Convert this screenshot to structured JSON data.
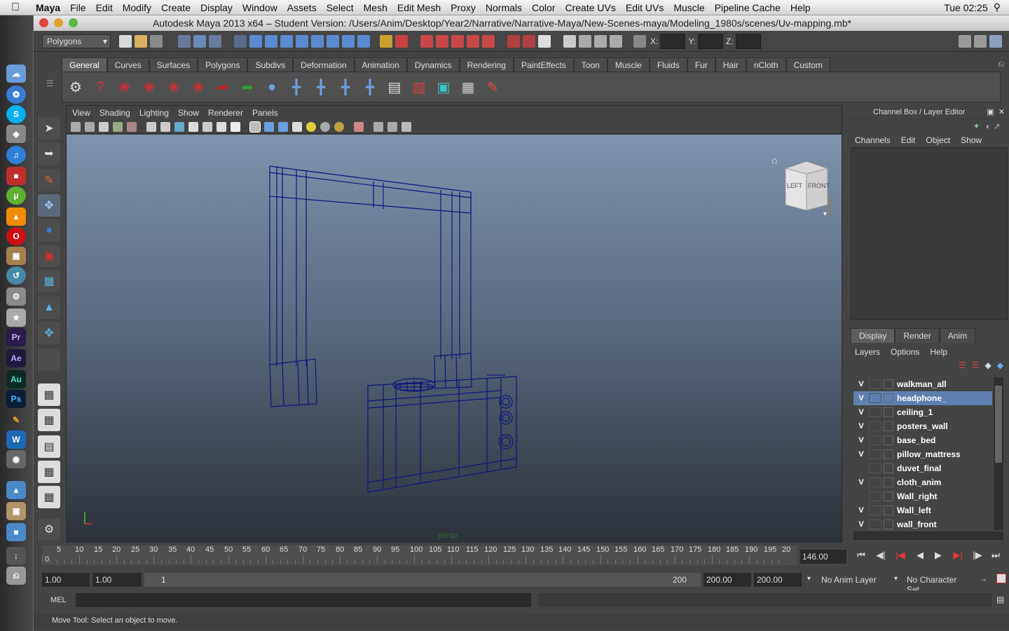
{
  "mac_menu": {
    "app": "Maya",
    "items": [
      "File",
      "Edit",
      "Modify",
      "Create",
      "Display",
      "Window",
      "Assets",
      "Select",
      "Mesh",
      "Edit Mesh",
      "Proxy",
      "Normals",
      "Color",
      "Create UVs",
      "Edit UVs",
      "Muscle",
      "Pipeline Cache",
      "Help"
    ],
    "clock": "Tue 02:25"
  },
  "window": {
    "title": "Autodesk Maya 2013 x64 – Student Version: /Users/Anim/Desktop/Year2/Narrative/Narrative-Maya/New-Scenes-maya/Modeling_1980s/scenes/Uv-mapping.mb*"
  },
  "toolbar": {
    "mode": "Polygons",
    "x_label": "X:",
    "y_label": "Y:",
    "z_label": "Z:"
  },
  "shelf_tabs": [
    "General",
    "Curves",
    "Surfaces",
    "Polygons",
    "Subdivs",
    "Deformation",
    "Animation",
    "Dynamics",
    "Rendering",
    "PaintEffects",
    "Toon",
    "Muscle",
    "Fluids",
    "Fur",
    "Hair",
    "nCloth",
    "Custom"
  ],
  "viewport": {
    "menu": [
      "View",
      "Shading",
      "Lighting",
      "Show",
      "Renderer",
      "Panels"
    ],
    "camera_label": "persp",
    "cube_left": "LEFT",
    "cube_front": "FRONT"
  },
  "channel_box": {
    "title": "Channel Box / Layer Editor",
    "menu": [
      "Channels",
      "Edit",
      "Object",
      "Show"
    ]
  },
  "layer_editor": {
    "tabs": [
      "Display",
      "Render",
      "Anim"
    ],
    "menu": [
      "Layers",
      "Options",
      "Help"
    ],
    "layers": [
      {
        "v": "V",
        "name": "walkman_all"
      },
      {
        "v": "V",
        "name": "headphone_"
      },
      {
        "v": "V",
        "name": "ceiling_1"
      },
      {
        "v": "V",
        "name": "posters_wall"
      },
      {
        "v": "V",
        "name": "base_bed"
      },
      {
        "v": "V",
        "name": "pillow_mattress"
      },
      {
        "v": "",
        "name": "duvet_final"
      },
      {
        "v": "V",
        "name": "cloth_anim"
      },
      {
        "v": "",
        "name": "Wall_right"
      },
      {
        "v": "V",
        "name": "Wall_left"
      },
      {
        "v": "V",
        "name": "wall_front"
      }
    ]
  },
  "timeline": {
    "ticks": [
      "5",
      "10",
      "15",
      "20",
      "25",
      "30",
      "35",
      "40",
      "45",
      "50",
      "55",
      "60",
      "65",
      "70",
      "75",
      "80",
      "85",
      "90",
      "95",
      "100",
      "105",
      "110",
      "115",
      "120",
      "125",
      "130",
      "135",
      "140",
      "145",
      "150",
      "155",
      "160",
      "165",
      "170",
      "175",
      "180",
      "185",
      "190",
      "195",
      "20"
    ],
    "start_tick": "0",
    "current_frame": "146.00"
  },
  "range": {
    "start": "1.00",
    "playback_start": "1.00",
    "slider_start": "1",
    "slider_end": "200",
    "playback_end": "200.00",
    "end": "200.00",
    "anim_layer": "No Anim Layer",
    "character_set": "No Character Set"
  },
  "command": {
    "lang": "MEL"
  },
  "help_line": "Move Tool: Select an object to move."
}
